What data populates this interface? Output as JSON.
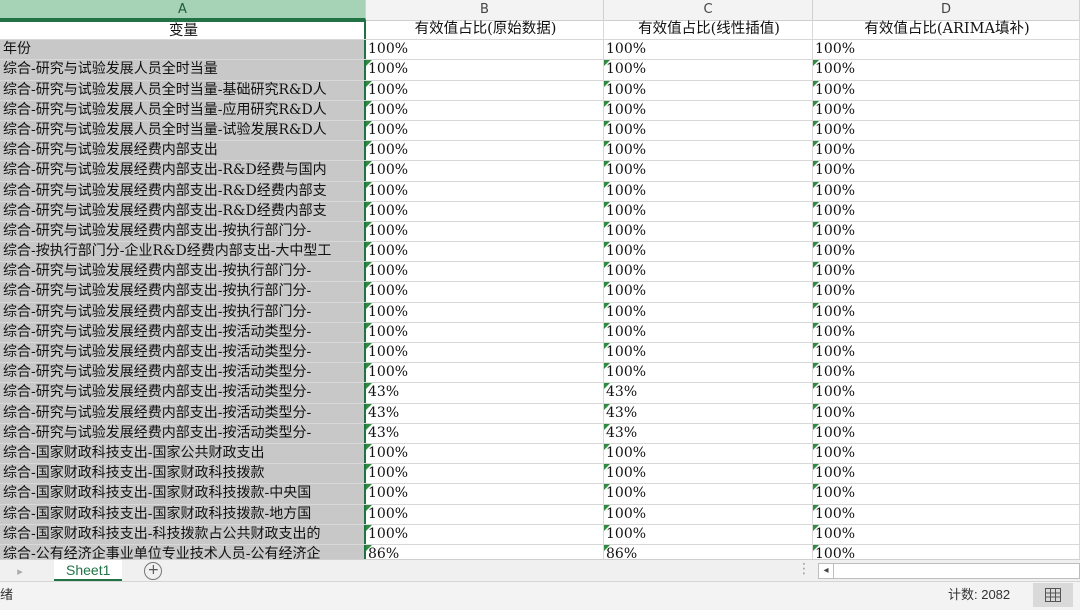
{
  "columns": [
    "A",
    "B",
    "C",
    "D"
  ],
  "header": [
    "变量",
    "有效值占比(原始数据)",
    "有效值占比(线性插值)",
    "有效值占比(ARIMA填补)"
  ],
  "rows": [
    [
      "年份",
      "100%",
      "100%",
      "100%"
    ],
    [
      "综合-研究与试验发展人员全时当量",
      "100%",
      "100%",
      "100%"
    ],
    [
      "综合-研究与试验发展人员全时当量-基础研究R&D人",
      "100%",
      "100%",
      "100%"
    ],
    [
      "综合-研究与试验发展人员全时当量-应用研究R&D人",
      "100%",
      "100%",
      "100%"
    ],
    [
      "综合-研究与试验发展人员全时当量-试验发展R&D人",
      "100%",
      "100%",
      "100%"
    ],
    [
      "综合-研究与试验发展经费内部支出",
      "100%",
      "100%",
      "100%"
    ],
    [
      "综合-研究与试验发展经费内部支出-R&D经费与国内",
      "100%",
      "100%",
      "100%"
    ],
    [
      "综合-研究与试验发展经费内部支出-R&D经费内部支",
      "100%",
      "100%",
      "100%"
    ],
    [
      "综合-研究与试验发展经费内部支出-R&D经费内部支",
      "100%",
      "100%",
      "100%"
    ],
    [
      "综合-研究与试验发展经费内部支出-按执行部门分-",
      "100%",
      "100%",
      "100%"
    ],
    [
      "综合-按执行部门分-企业R&D经费内部支出-大中型工",
      "100%",
      "100%",
      "100%"
    ],
    [
      "综合-研究与试验发展经费内部支出-按执行部门分-",
      "100%",
      "100%",
      "100%"
    ],
    [
      "综合-研究与试验发展经费内部支出-按执行部门分-",
      "100%",
      "100%",
      "100%"
    ],
    [
      "综合-研究与试验发展经费内部支出-按执行部门分-",
      "100%",
      "100%",
      "100%"
    ],
    [
      "综合-研究与试验发展经费内部支出-按活动类型分-",
      "100%",
      "100%",
      "100%"
    ],
    [
      "综合-研究与试验发展经费内部支出-按活动类型分-",
      "100%",
      "100%",
      "100%"
    ],
    [
      "综合-研究与试验发展经费内部支出-按活动类型分-",
      "100%",
      "100%",
      "100%"
    ],
    [
      "综合-研究与试验发展经费内部支出-按活动类型分-",
      "43%",
      "43%",
      "100%"
    ],
    [
      "综合-研究与试验发展经费内部支出-按活动类型分-",
      "43%",
      "43%",
      "100%"
    ],
    [
      "综合-研究与试验发展经费内部支出-按活动类型分-",
      "43%",
      "43%",
      "100%"
    ],
    [
      "综合-国家财政科技支出-国家公共财政支出",
      "100%",
      "100%",
      "100%"
    ],
    [
      "综合-国家财政科技支出-国家财政科技拨款",
      "100%",
      "100%",
      "100%"
    ],
    [
      "综合-国家财政科技支出-国家财政科技拨款-中央国",
      "100%",
      "100%",
      "100%"
    ],
    [
      "综合-国家财政科技支出-国家财政科技拨款-地方国",
      "100%",
      "100%",
      "100%"
    ],
    [
      "综合-国家财政科技支出-科技拨款占公共财政支出的",
      "100%",
      "100%",
      "100%"
    ],
    [
      "综合-公有经济企事业单位专业技术人员-公有经济企",
      "86%",
      "86%",
      "100%"
    ]
  ],
  "sheet_tab": "Sheet1",
  "status": {
    "left": "绪",
    "count": "计数: 2082"
  }
}
